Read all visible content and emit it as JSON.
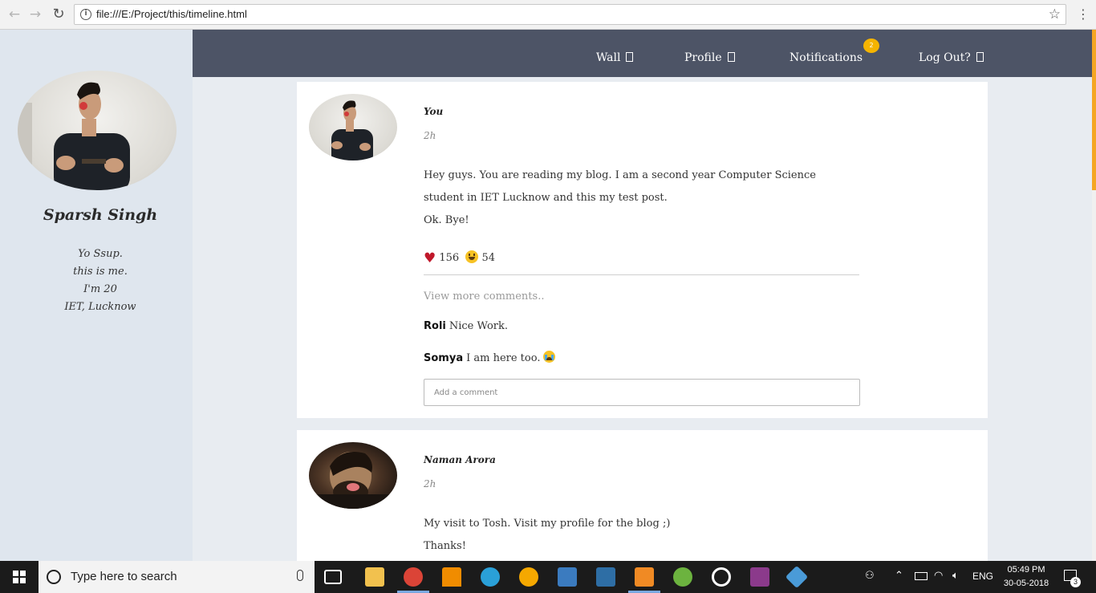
{
  "browser": {
    "url": "file:///E:/Project/this/timeline.html",
    "back_icon": "←",
    "forward_icon": "→",
    "reload_icon": "↻",
    "info_icon": "i",
    "star_icon": "☆",
    "menu_icon": "⋮"
  },
  "sidebar": {
    "name": "Sparsh Singh",
    "bio": [
      "Yo Ssup.",
      "this is me.",
      "I'm 20",
      "IET, Lucknow"
    ]
  },
  "nav": {
    "wall": "Wall",
    "profile": "Profile",
    "notifications": "Notifications",
    "notifications_badge": "2",
    "logout": "Log Out?"
  },
  "posts": [
    {
      "author": "You",
      "time": "2h",
      "body": [
        "Hey guys. You are reading my blog. I am a second year Computer Science",
        "student in IET Lucknow and this my test post.",
        "Ok. Bye!"
      ],
      "reactions": {
        "hearts": "156",
        "smiles": "54"
      },
      "view_more": "View more comments..",
      "comments": [
        {
          "user": "Roli",
          "text": "Nice Work."
        },
        {
          "user": "Somya",
          "text": "I am here too."
        }
      ],
      "comment_placeholder": "Add a comment"
    },
    {
      "author": "Naman Arora",
      "time": "2h",
      "body": [
        "My visit to Tosh. Visit my profile for the blog ;)",
        "Thanks!"
      ]
    }
  ],
  "taskbar": {
    "search_placeholder": "Type here to search",
    "language": "ENG",
    "time": "05:49 PM",
    "date": "30-05-2018",
    "notification_count": "3"
  },
  "colors": {
    "nav_bg": "#4d5466",
    "badge": "#f5b400",
    "sidebar_bg": "#dfe6ee",
    "heart": "#c0182b"
  }
}
